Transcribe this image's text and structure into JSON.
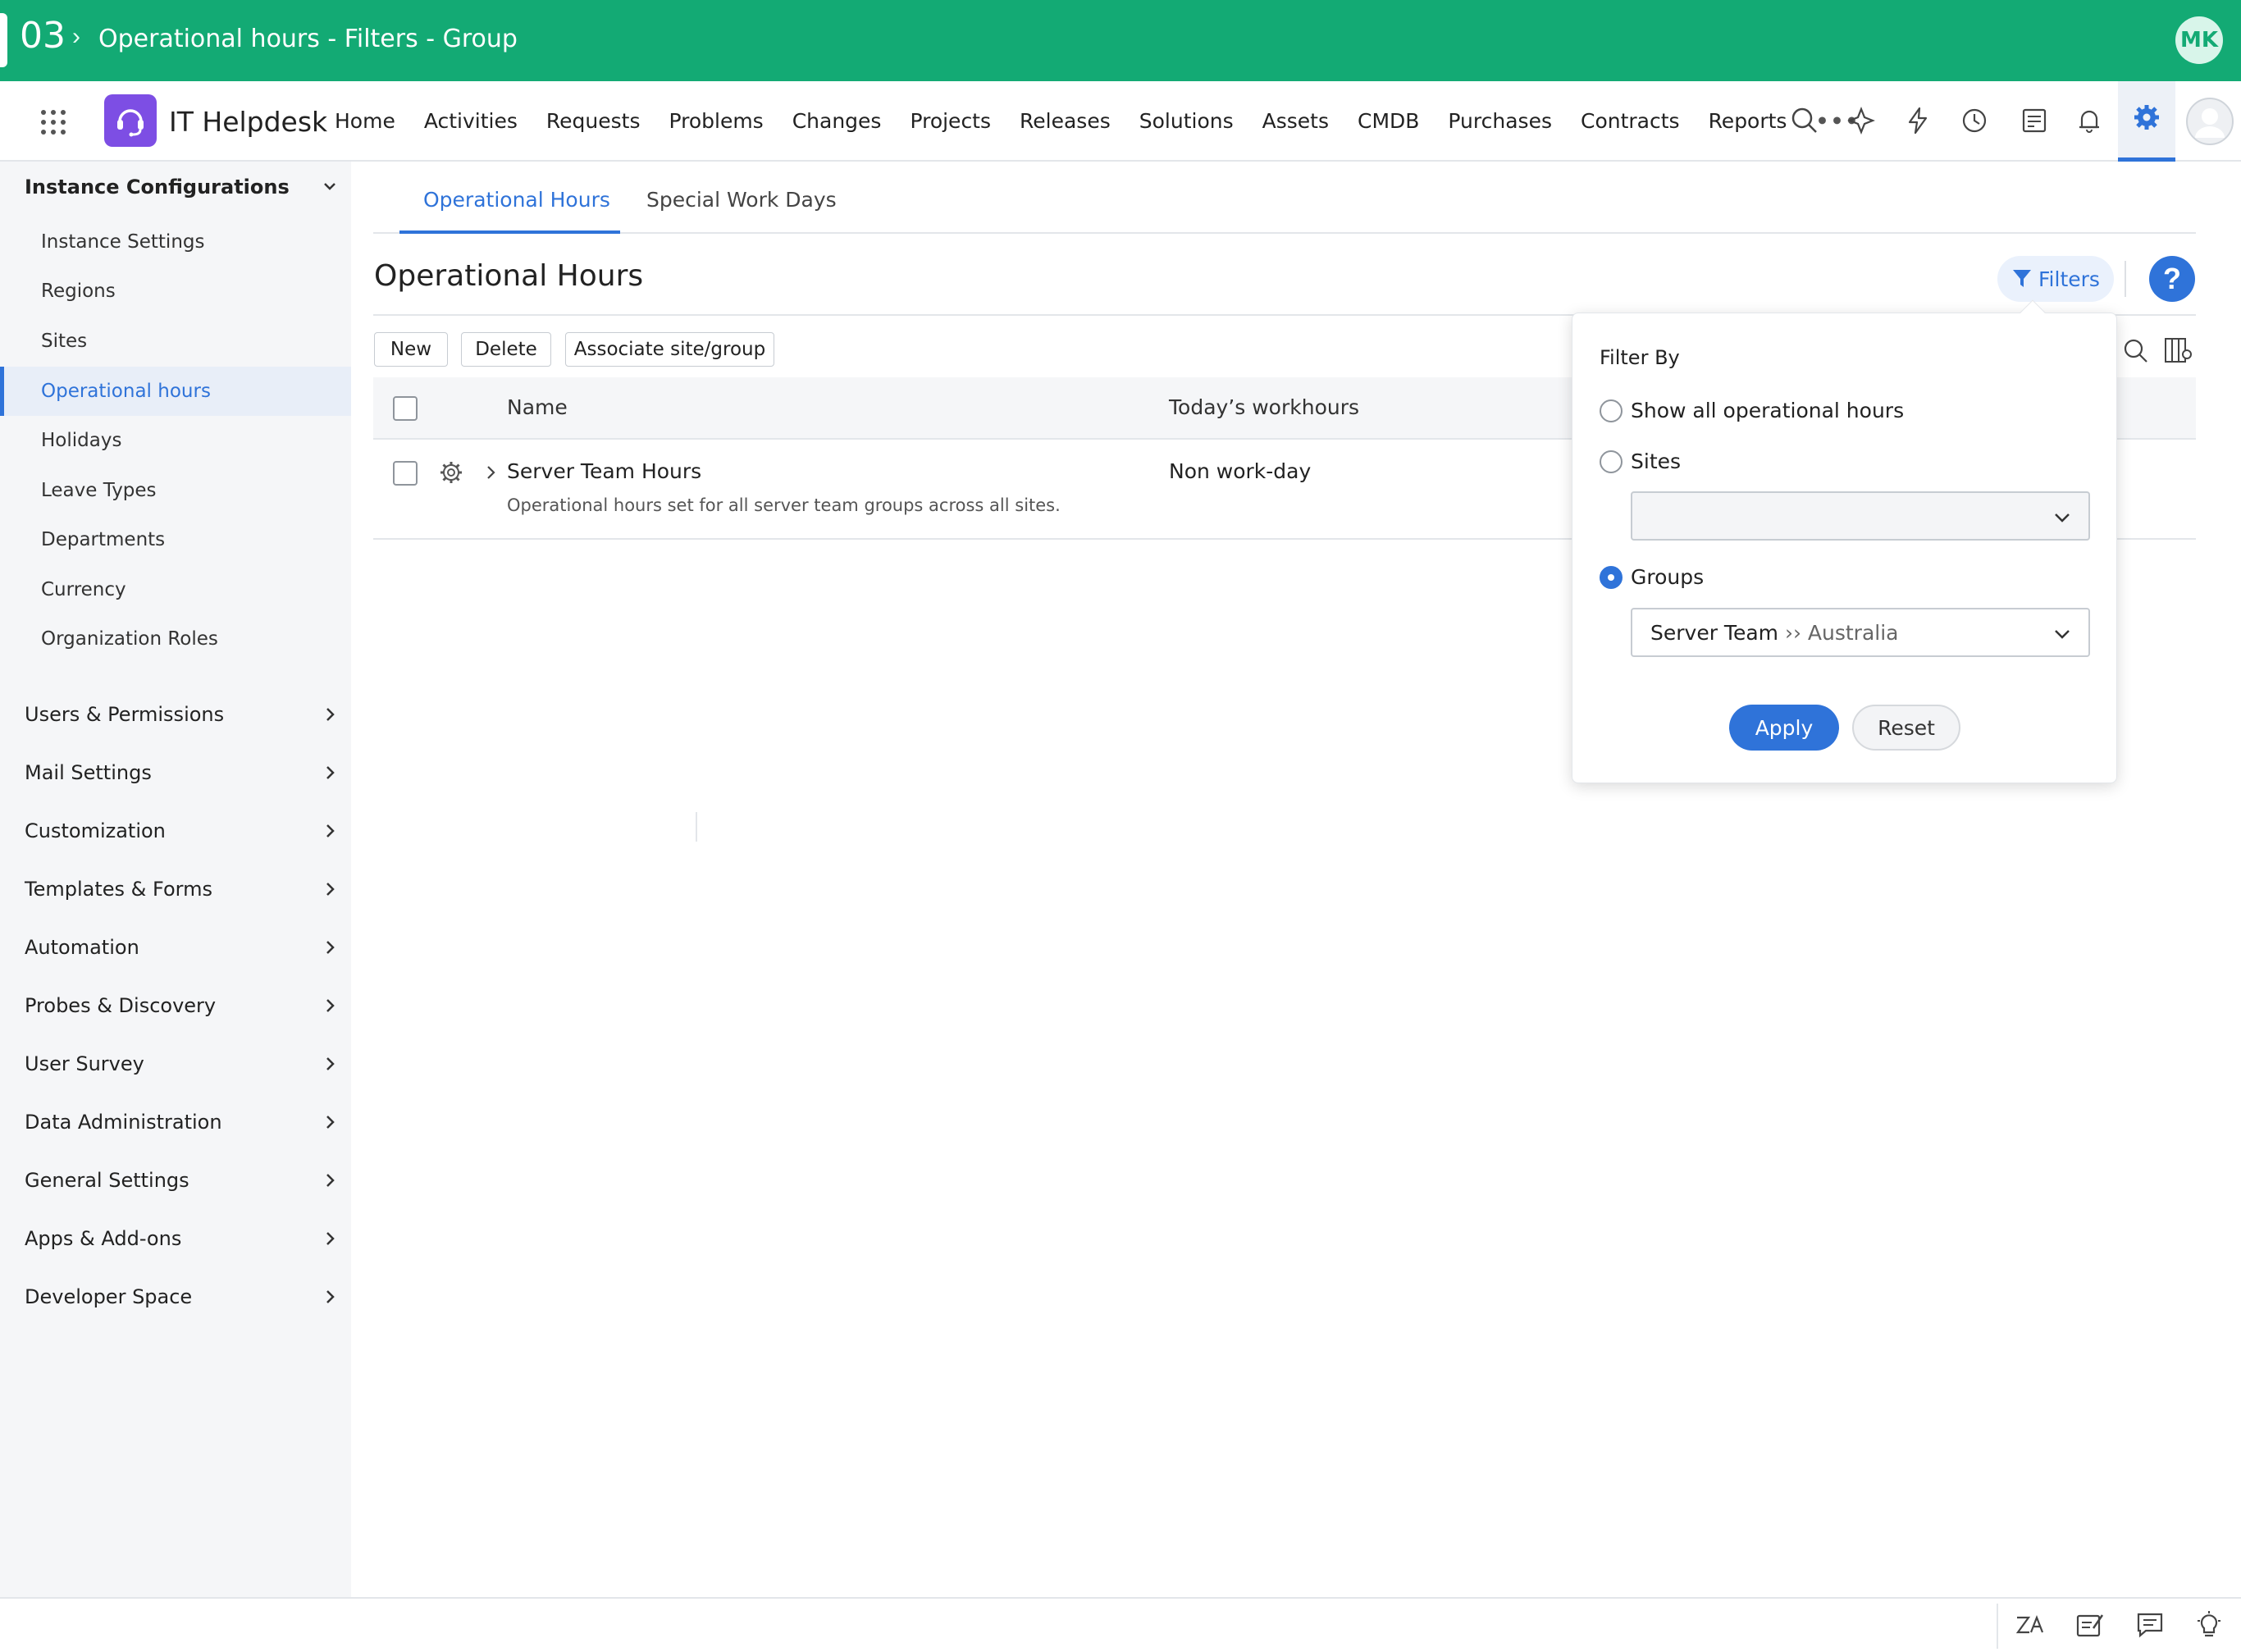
{
  "banner": {
    "step_number": "03",
    "title": "Operational hours - Filters - Group",
    "avatar_initials": "MK",
    "color": "#13aa74"
  },
  "header": {
    "brand": "IT Helpdesk",
    "nav": [
      "Home",
      "Activities",
      "Requests",
      "Problems",
      "Changes",
      "Projects",
      "Releases",
      "Solutions",
      "Assets",
      "CMDB",
      "Purchases",
      "Contracts",
      "Reports"
    ],
    "more": "•••",
    "icons": [
      "search-icon",
      "magic-wand-icon",
      "lightning-icon",
      "history-icon",
      "checklist-icon",
      "bell-icon",
      "gear-icon",
      "user-avatar-icon"
    ]
  },
  "sidebar": {
    "section_title": "Instance Configurations",
    "items": [
      "Instance Settings",
      "Regions",
      "Sites",
      "Operational hours",
      "Holidays",
      "Leave Types",
      "Departments",
      "Currency",
      "Organization Roles"
    ],
    "active_item": "Operational hours",
    "sections": [
      "Users & Permissions",
      "Mail Settings",
      "Customization",
      "Templates & Forms",
      "Automation",
      "Probes & Discovery",
      "User Survey",
      "Data Administration",
      "General Settings",
      "Apps & Add-ons",
      "Developer Space"
    ]
  },
  "tabs": {
    "active": "Operational Hours",
    "inactive": "Special Work Days"
  },
  "page": {
    "title": "Operational Hours",
    "filters_label": "Filters",
    "help": "?",
    "accent": "#2f73d9"
  },
  "toolbar": {
    "new": "New",
    "delete": "Delete",
    "associate": "Associate site/group"
  },
  "table": {
    "headers": {
      "name": "Name",
      "workhours": "Today’s workhours"
    },
    "rows": [
      {
        "name": "Server Team Hours",
        "description": "Operational hours set for all server team groups across all sites.",
        "workhours": "Non work-day"
      }
    ]
  },
  "filter": {
    "title": "Filter By",
    "options": {
      "all": "Show all operational hours",
      "sites": "Sites",
      "groups": "Groups"
    },
    "selected": "Groups",
    "sites_value": "",
    "group_value": "Server Team",
    "group_path": "›› Australia",
    "apply": "Apply",
    "reset": "Reset"
  },
  "footer": {
    "icons": [
      "translate-icon",
      "notes-icon",
      "chat-icon",
      "lightbulb-icon"
    ]
  }
}
